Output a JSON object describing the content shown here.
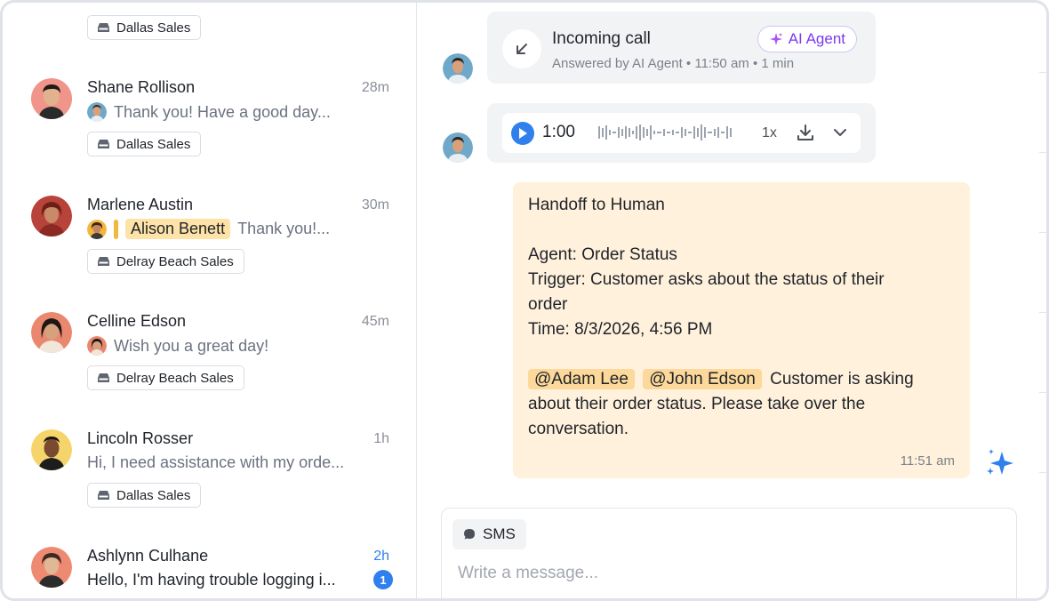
{
  "conversations": [
    {
      "tag": "Dallas Sales"
    },
    {
      "name": "Shane Rollison",
      "time": "28m",
      "preview": "Thank you! Have a good day...",
      "tag": "Dallas Sales"
    },
    {
      "name": "Marlene Austin",
      "time": "30m",
      "mention": "Alison Benett",
      "preview": "Thank you!...",
      "tag": "Delray Beach Sales"
    },
    {
      "name": "Celline Edson",
      "time": "45m",
      "preview": "Wish you a great day!",
      "tag": "Delray Beach Sales"
    },
    {
      "name": "Lincoln Rosser",
      "time": "1h",
      "preview": "Hi, I need assistance with my orde...",
      "tag": "Dallas Sales"
    },
    {
      "name": "Ashlynn Culhane",
      "time": "2h",
      "preview": "Hello, I'm having trouble logging i...",
      "unread_count": "1"
    }
  ],
  "call": {
    "title": "Incoming call",
    "subtitle": "Answered by AI Agent • 11:50 am • 1 min",
    "badge": "AI Agent"
  },
  "audio": {
    "duration": "1:00",
    "speed": "1x"
  },
  "handoff": {
    "title": "Handoff to Human",
    "agent": "Agent: Order Status",
    "trigger_line1": "Trigger: Customer asks about the status of their",
    "trigger_line2": "order",
    "time_line": "Time: 8/3/2026, 4:56 PM",
    "mention1": "@Adam Lee",
    "mention2": "@John Edson",
    "body_line1": "Customer is asking",
    "body_line2": "about their order status. Please take over the",
    "body_line3": "conversation.",
    "timestamp": "11:51 am"
  },
  "composer": {
    "channel": "SMS",
    "placeholder": "Write a message..."
  },
  "colors": {
    "accent": "#2f80ed",
    "ai_purple": "#7c3aed",
    "handoff_bg": "#fff1dc",
    "mention_bg": "#fcd99a"
  },
  "icons": {
    "inbox": "inbox-icon",
    "call": "incoming-call-arrow-icon",
    "sparkle": "sparkle-icon",
    "play": "play-icon",
    "download": "download-icon",
    "chevron": "chevron-down-icon",
    "sms": "chat-bubble-icon"
  }
}
